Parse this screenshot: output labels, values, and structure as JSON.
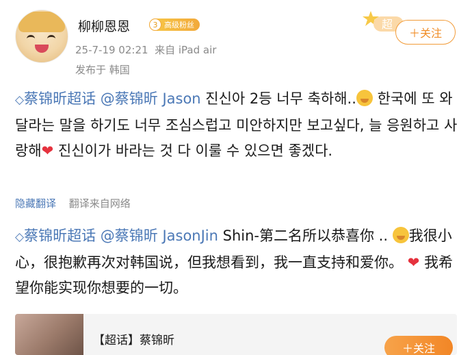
{
  "user": {
    "name": "柳柳恩恩",
    "badge_level": "3",
    "badge_text": "高级粉丝",
    "timestamp": "25-7-19 02:21",
    "source": "来自 iPad air",
    "location": "发布于 韩国"
  },
  "header": {
    "super_tag": "超",
    "follow_label": "＋关注"
  },
  "post": {
    "korean": {
      "topic_link": "蔡锦昕超话",
      "mention": "@蔡锦昕 Jason",
      "text_a": " 진신아 2등 너무 축하해..",
      "text_b": " 한국에 또 와달라는 말을 하기도 너무 조심스럽고 미안하지만 보고싶다, 늘 응원하고 사랑해",
      "text_c": " 진신이가 바라는 것 다 이룰 수 있으면 좋겠다."
    },
    "translation_controls": {
      "hide_label": "隐藏翻译",
      "source_label": "翻译来自网络"
    },
    "chinese": {
      "topic_link": "蔡锦昕超话",
      "mention": "@蔡锦昕 JasonJin",
      "text_a": " Shin-第二名所以恭喜你 ..",
      "text_b": "我很小心，很抱歉再次对韩国说，但我想看到，我一直支持和爱你。",
      "text_c": " 我希望你能实现你想要的一切。"
    }
  },
  "card": {
    "title": "【超话】蔡锦昕",
    "follow_label": "＋关注"
  },
  "colors": {
    "link": "#4b78b6",
    "accent": "#f08d27",
    "heart": "#e5323e"
  },
  "icons": [
    "avatar",
    "diamond-icon",
    "pensive-emoji-icon",
    "heart-icon"
  ]
}
